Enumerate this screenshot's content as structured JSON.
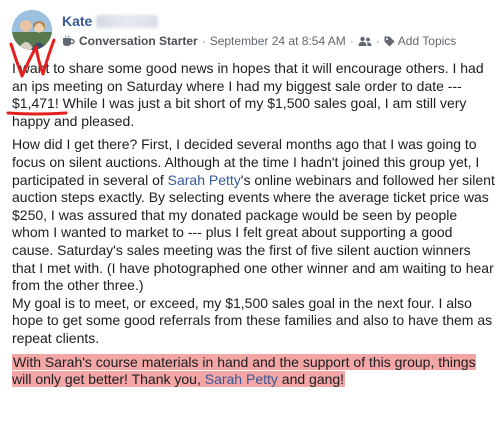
{
  "post": {
    "author_name": "Kate",
    "badge_label": "Conversation Starter",
    "separator": "·",
    "timestamp": "September 24 at 8:54 AM",
    "add_topics_label": "Add Topics",
    "icons": {
      "badge": "coffee-cup-icon",
      "audience": "group-icon",
      "topics": "tag-icon"
    }
  },
  "body": {
    "p1_a": "I want to share some good news in hopes that it will encourage others. I had an ips meeting on Saturday where I had my biggest sale order to date --- ",
    "p1_amount": "$1,471",
    "p1_b": "! While I was just a bit short of my $1,500 sales goal, I am still very happy and pleased.",
    "p2_a": "How did I get there? First, I decided several months ago that I was going to focus on silent auctions. Although at the time I hadn't joined this group yet, I participated in several of ",
    "p2_link": "Sarah Petty",
    "p2_b": "'s online webinars and followed her silent auction steps exactly. By selecting events where the average ticket price was $250, I was assured that my donated package would be seen by people whom I wanted to market to --- plus I felt great about supporting a good cause. Saturday's sales meeting was the first of five silent auction winners that I met with. (I have photographed one other winner and am waiting to hear from the other three.)",
    "p3": "My goal is to meet, or exceed, my $1,500 sales goal in the next four. I also hope to get some good referrals from these families and also to have them as repeat clients.",
    "p4_a": "With Sarah's course materials in hand and the support of this group, things will only get better! Thank you, ",
    "p4_link": "Sarah Petty",
    "p4_b": " and gang!"
  },
  "colors": {
    "author": "#385898",
    "link": "#365899",
    "highlight": "#f3a6a6",
    "annotation": "#e4201e",
    "meta_text": "#616770"
  }
}
